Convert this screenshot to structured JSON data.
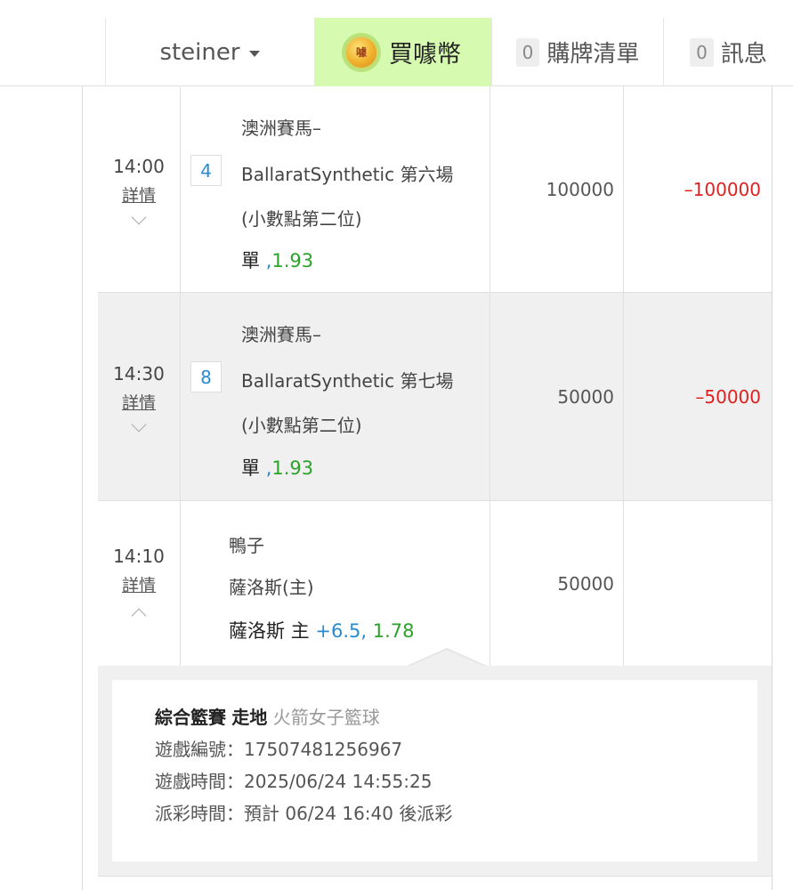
{
  "header": {
    "username": "steiner",
    "buy_coin_label": "買噱幣",
    "coin_text": "噱",
    "cart_count": "0",
    "cart_label": "購牌清單",
    "msg_count": "0",
    "msg_label": "訊息"
  },
  "bets": [
    {
      "time": "14:00",
      "detail_label": "詳情",
      "number": "4",
      "lines": [
        "澳洲賽馬–",
        "BallaratSynthetic 第六場",
        "(小數點第二位)"
      ],
      "pick": "單",
      "comma": ",",
      "odds": "1.93",
      "amount": "100000",
      "result": "–100000"
    },
    {
      "time": "14:30",
      "detail_label": "詳情",
      "number": "8",
      "lines": [
        "澳洲賽馬–",
        "BallaratSynthetic 第七場",
        "(小數點第二位)"
      ],
      "pick": "單",
      "comma": ",",
      "odds": "1.93",
      "amount": "50000",
      "result": "–50000"
    },
    {
      "time": "14:10",
      "detail_label": "詳情",
      "lines": [
        "鴨子",
        "薩洛斯(主)"
      ],
      "pick": "薩洛斯 主",
      "handicap": "+6.5,",
      "odds": "1.78",
      "amount": "50000",
      "result": ""
    }
  ],
  "detail": {
    "category": "綜合籃賽",
    "type": "走地",
    "league": "火箭女子籃球",
    "game_id_label": "遊戲編號：",
    "game_id": "17507481256967",
    "game_time_label": "遊戲時間：",
    "game_time": "2025/06/24 14:55:25",
    "payout_label": "派彩時間：",
    "payout": "預計 06/24 16:40 後派彩"
  },
  "colors": {
    "buy_bg": "#d6fbb0",
    "odds": "#2aa32a",
    "link_blue": "#2a8bd0",
    "loss": "#e02020"
  }
}
